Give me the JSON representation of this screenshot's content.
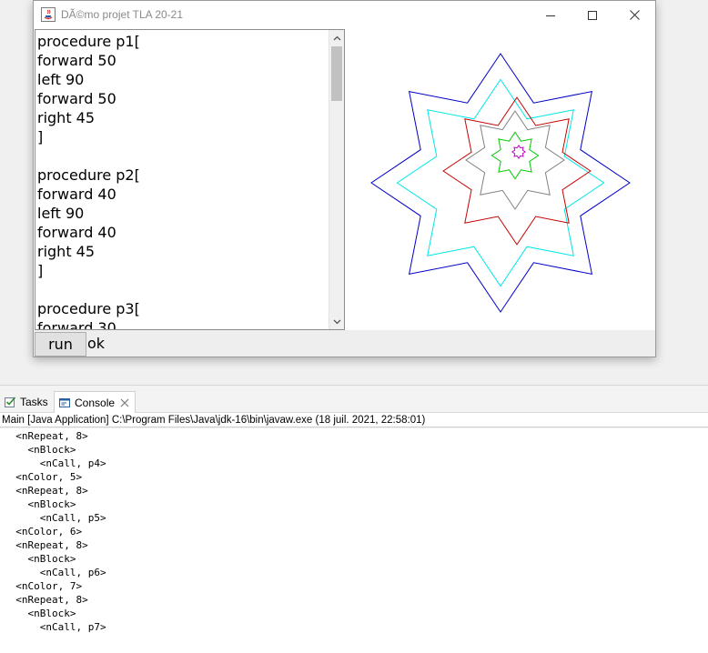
{
  "window": {
    "title": "DÃ©mo projet TLA 20-21",
    "icon": "java-coffee-icon"
  },
  "editor": {
    "code": "procedure p1[\nforward 50\nleft 90\nforward 50\nright 45\n]\n\nprocedure p2[\nforward 40\nleft 90\nforward 40\nright 45\n]\n\nprocedure p3[\nforward 30"
  },
  "bottom": {
    "run_label": "run",
    "status": "ok"
  },
  "drawing": {
    "colors": [
      "#0000c8",
      "#00e6e6",
      "#c80000",
      "#808080",
      "#00c800",
      "#c000c0"
    ]
  },
  "eclipse": {
    "tabs": [
      {
        "label": "Tasks",
        "icon": "tasks-icon"
      },
      {
        "label": "Console",
        "icon": "console-icon"
      }
    ],
    "console_header": "Main [Java Application] C:\\Program Files\\Java\\jdk-16\\bin\\javaw.exe  (18 juil. 2021, 22:58:01)",
    "console_output": "  <nRepeat, 8>\n    <nBlock>\n      <nCall, p4>\n  <nColor, 5>\n  <nRepeat, 8>\n    <nBlock>\n      <nCall, p5>\n  <nColor, 6>\n  <nRepeat, 8>\n    <nBlock>\n      <nCall, p6>\n  <nColor, 7>\n  <nRepeat, 8>\n    <nBlock>\n      <nCall, p7>"
  }
}
